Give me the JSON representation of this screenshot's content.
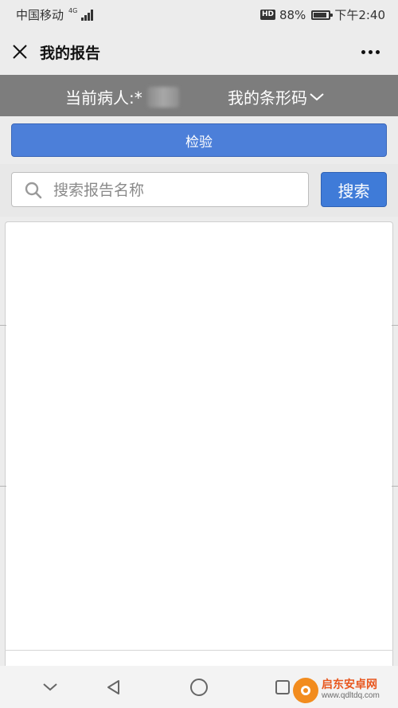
{
  "status_bar": {
    "carrier": "中国移动",
    "network": "4G",
    "hd": "HD",
    "battery_percent": "88%",
    "battery_level": 0.88,
    "time": "下午2:40"
  },
  "nav": {
    "title": "我的报告"
  },
  "patient_bar": {
    "label": "当前病人:*",
    "barcode_label": "我的条形码"
  },
  "tabs": [
    {
      "label": "检验"
    }
  ],
  "search": {
    "placeholder": "搜索报告名称",
    "value": "",
    "button_label": "搜索"
  },
  "watermark": {
    "title": "启东安卓网",
    "url": "www.qdltdq.com"
  },
  "colors": {
    "accent": "#4c7fd9",
    "patient_bar_bg": "#7d7d7d",
    "background": "#ececec"
  }
}
